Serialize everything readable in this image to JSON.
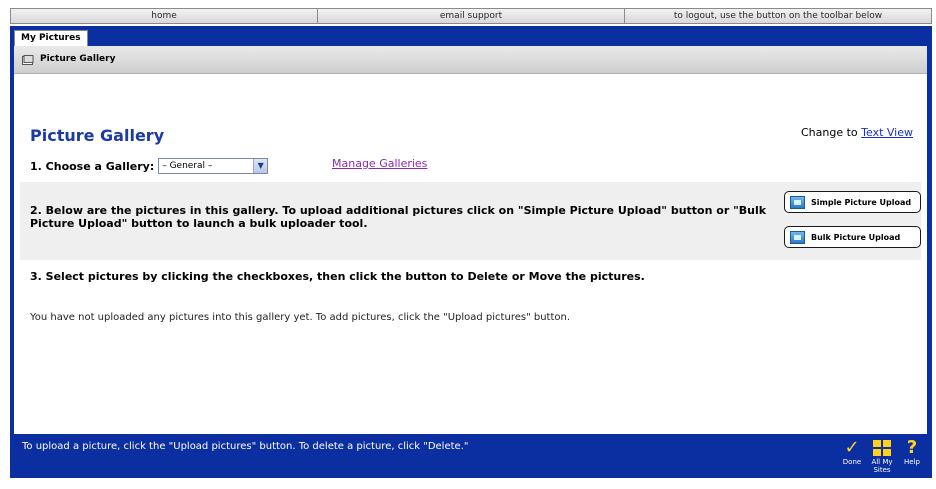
{
  "topnav": {
    "home": "home",
    "email": "email support",
    "logout": "to logout, use the button on the toolbar below"
  },
  "tab": {
    "label": "My Pictures"
  },
  "section": {
    "title": "Picture Gallery"
  },
  "main": {
    "heading": "Picture Gallery",
    "change_to": "Change to",
    "text_view": "Text View",
    "step1_label": "1. Choose a Gallery:",
    "gallery_selected": "– General –",
    "manage_galleries": "Manage Galleries",
    "step2_text": "2. Below are the pictures in this gallery. To upload additional pictures click on \"Simple Picture Upload\" button or \"Bulk Picture Upload\" button to launch a bulk uploader tool.",
    "simple_upload": "Simple Picture Upload",
    "bulk_upload": "Bulk Picture Upload",
    "step3_text": "3. Select pictures by clicking the checkboxes, then click the button to Delete or Move the pictures.",
    "empty_message": "You have not uploaded any pictures into this gallery yet. To add pictures, click the \"Upload pictures\" button."
  },
  "footer": {
    "hint": "To upload a picture, click the \"Upload pictures\" button. To delete a picture, click \"Delete.\"",
    "done": "Done",
    "all_my_sites": "All My Sites",
    "help": "Help"
  },
  "colors": {
    "frame_blue": "#0b2fa0",
    "heading_blue": "#1c3aa6",
    "link_purple": "#8a2aa7",
    "icon_yellow": "#ffd21f"
  }
}
